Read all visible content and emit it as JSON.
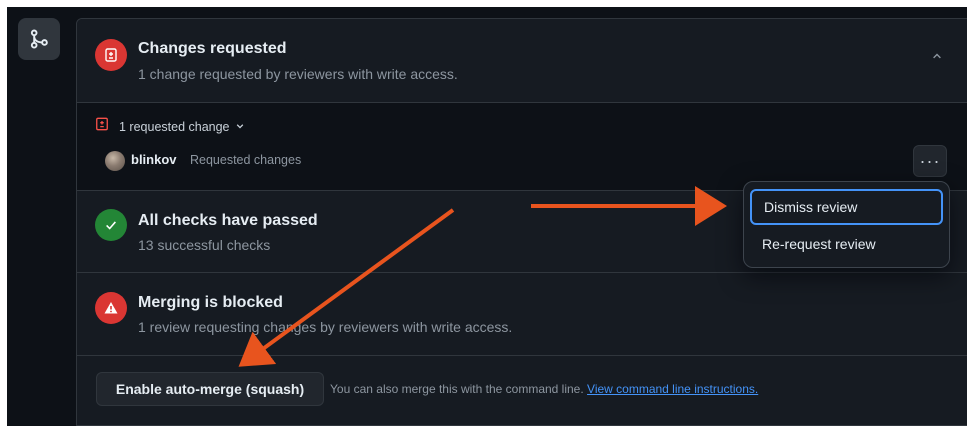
{
  "changes": {
    "title": "Changes requested",
    "subtitle": "1 change requested by reviewers with write access.",
    "requested_toggle": "1 requested change",
    "reviewer_name": "blinkov",
    "reviewer_status": "Requested changes",
    "kebab_label": "···",
    "status_color": "#da3633"
  },
  "menu": {
    "items": [
      {
        "label": "Dismiss review"
      },
      {
        "label": "Re-request review"
      }
    ]
  },
  "checks": {
    "title": "All checks have passed",
    "subtitle": "13 successful checks",
    "status_color": "#238636"
  },
  "blocked": {
    "title": "Merging is blocked",
    "subtitle": "1 review requesting changes by reviewers with write access.",
    "status_color": "#da3633"
  },
  "actions": {
    "button_label": "Enable auto-merge (squash)",
    "help_text": "You can also merge this with the command line. ",
    "help_link": "View command line instructions."
  },
  "annotation": {
    "arrow_color": "#e8541e"
  },
  "icons": {
    "merge": "git-merge-icon",
    "file_diff": "file-diff-icon",
    "check": "check-icon",
    "alert": "alert-icon",
    "chevron_up": "chevron-up-icon",
    "chevron_down": "chevron-down-icon",
    "kebab": "kebab-horizontal-icon"
  }
}
